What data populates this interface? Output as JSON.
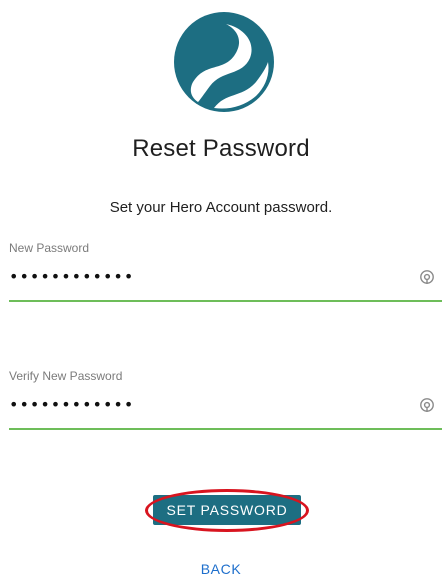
{
  "header": {
    "logo_icon": "hero-logo-icon",
    "logo_color": "#1d6e82"
  },
  "title": "Reset Password",
  "subtitle": "Set your Hero Account password.",
  "form": {
    "new_password": {
      "label": "New Password",
      "value": "••••••••••••",
      "icon": "eye-reveal-icon"
    },
    "verify_password": {
      "label": "Verify New Password",
      "value": "••••••••••••",
      "icon": "eye-reveal-icon"
    },
    "underline_color": "#6dbd59"
  },
  "actions": {
    "set_password_label": "SET PASSWORD",
    "set_password_color": "#1d6e82",
    "highlight_color": "#d8141f",
    "back_label": "BACK",
    "back_color": "#1e6fcc"
  }
}
